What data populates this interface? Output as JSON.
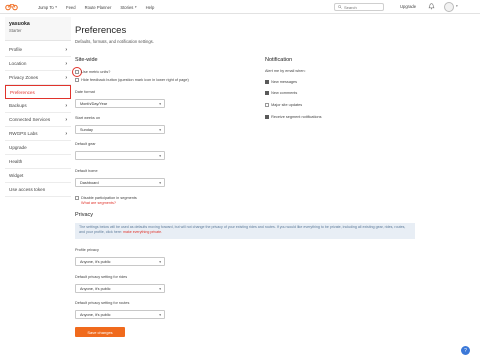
{
  "nav": {
    "items": [
      {
        "label": "Jump To",
        "caret": "▾"
      },
      {
        "label": "Feed",
        "caret": ""
      },
      {
        "label": "Route Planner",
        "caret": ""
      },
      {
        "label": "Stories",
        "caret": "▾"
      },
      {
        "label": "Help",
        "caret": ""
      }
    ],
    "search_placeholder": "Search",
    "upgrade": "Upgrade"
  },
  "sidebar": {
    "user_name": "yasuoka",
    "user_plan": "Starter",
    "items": [
      {
        "label": "Profile",
        "chev": "›"
      },
      {
        "label": "Location",
        "chev": "›"
      },
      {
        "label": "Privacy Zones",
        "chev": "›"
      },
      {
        "label": "Preferences",
        "chev": ""
      },
      {
        "label": "Backups",
        "chev": "›"
      },
      {
        "label": "Connected Services",
        "chev": "›"
      },
      {
        "label": "RWGPS Labs",
        "chev": "›"
      },
      {
        "label": "Upgrade",
        "chev": ""
      },
      {
        "label": "Health",
        "chev": ""
      },
      {
        "label": "Widget",
        "chev": ""
      },
      {
        "label": "Use access token",
        "chev": ""
      }
    ]
  },
  "main": {
    "title": "Preferences",
    "subtitle": "Defaults, formats, and notification settings.",
    "sitewide": {
      "heading": "Site-wide",
      "use_metric": "Use metric units?",
      "hide_feedback": "Hide feedback button (question mark icon in lower right of page)",
      "date_format_label": "Date format",
      "date_format_value": "Month/Day/Year",
      "week_start_label": "Start weeks on",
      "week_start_value": "Sunday",
      "default_gear_label": "Default gear",
      "default_gear_value": "",
      "default_home_label": "Default home",
      "default_home_value": "Dashboard",
      "disable_segments": "Disable participation in segments",
      "what_segments": "What are segments?"
    },
    "notification": {
      "heading": "Notification",
      "alert_label": "Alert me by email when:",
      "options": [
        {
          "label": "New messages",
          "checked": true
        },
        {
          "label": "New comments",
          "checked": true
        },
        {
          "label": "Major site updates",
          "checked": false
        },
        {
          "label": "Receive segment notifications",
          "checked": true
        }
      ]
    },
    "privacy": {
      "heading": "Privacy",
      "info_text": "The settings below will be used as defaults moving forward, but will not change the privacy of your existing rides and routes. If you would like everything to be private, including all existing gear, rides, routes, and your profile, click here:",
      "info_link": "make everything private.",
      "profile_privacy_label": "Profile privacy",
      "profile_privacy_value": "Anyone, it's public",
      "rides_privacy_label": "Default privacy setting for rides",
      "rides_privacy_value": "Anyone, it's public",
      "routes_privacy_label": "Default privacy setting for routes",
      "routes_privacy_value": "Anyone, it's public"
    },
    "save_label": "Save changes"
  },
  "help_fab": "?",
  "colors": {
    "accent": "#e0332b",
    "button": "#f06a1d",
    "info_bg": "#e8eef5",
    "fab": "#3b78d8"
  }
}
